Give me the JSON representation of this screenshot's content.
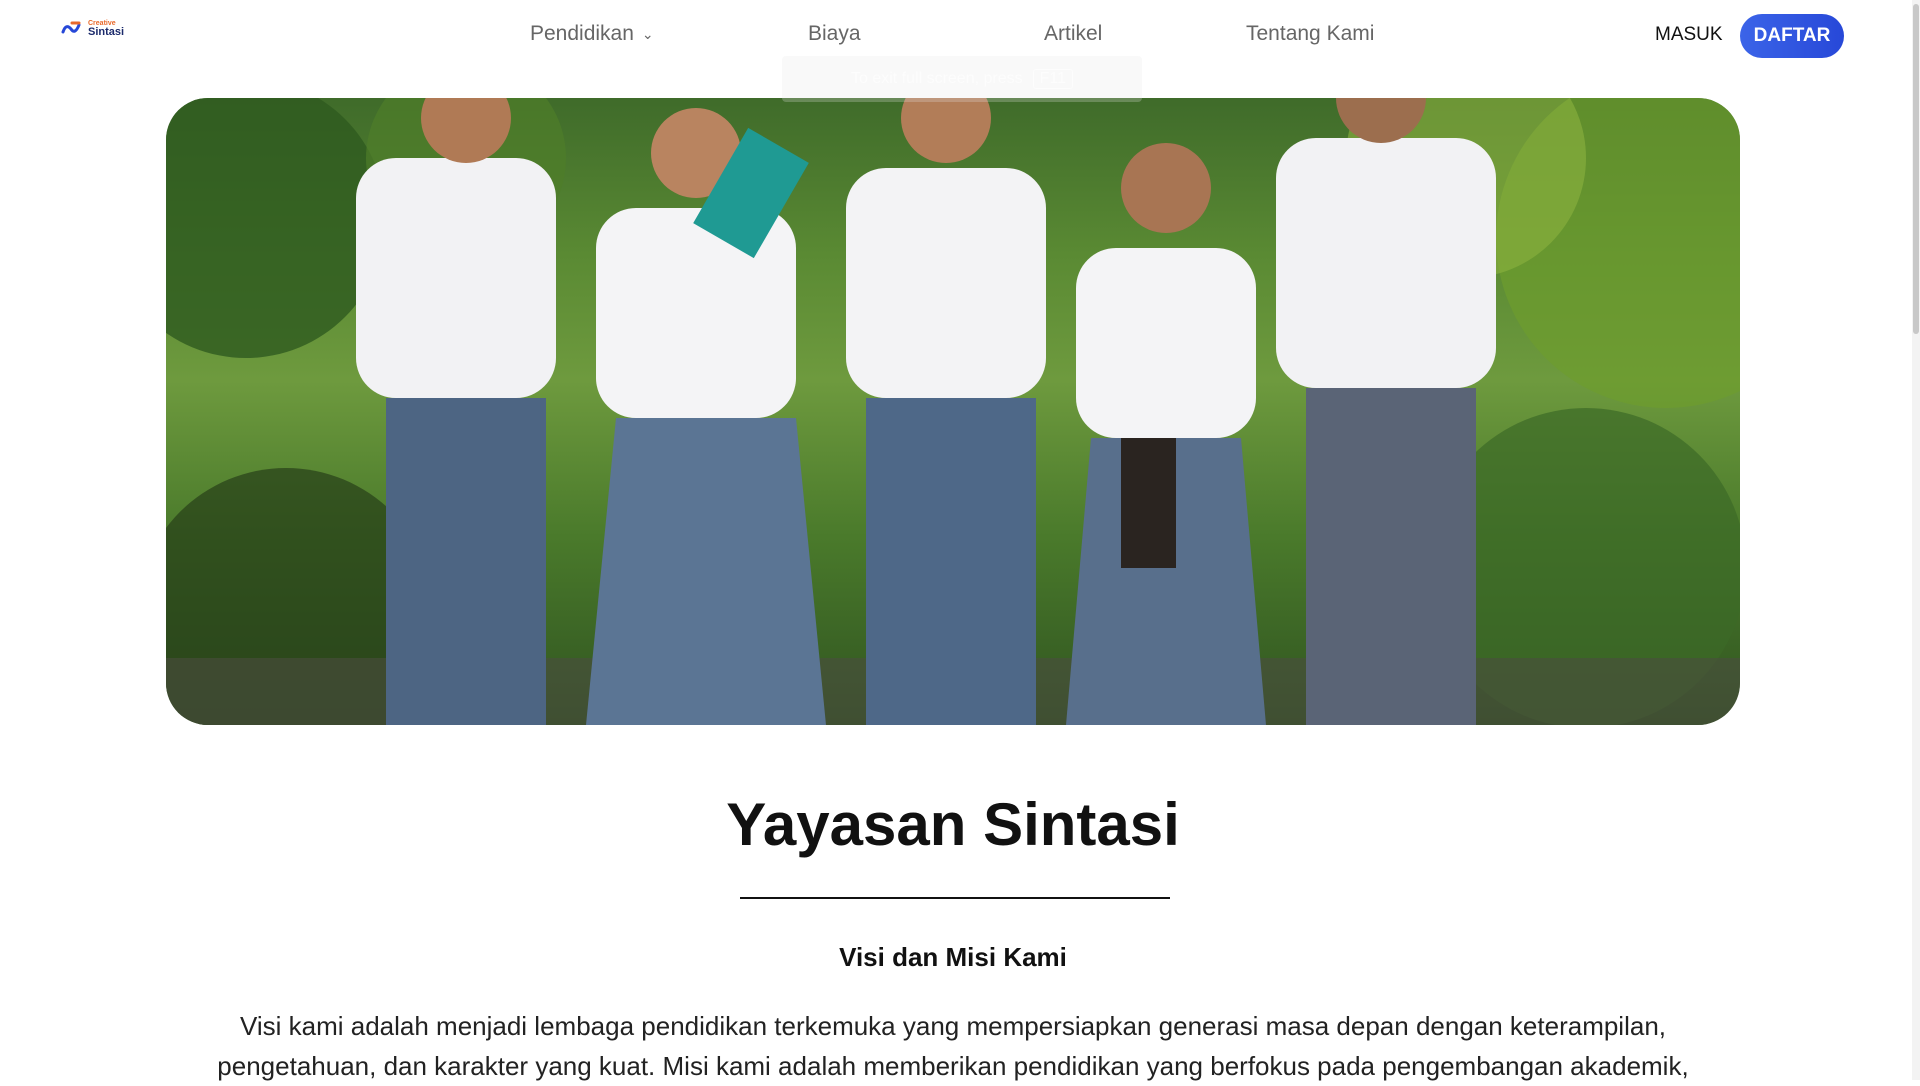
{
  "brand": {
    "small": "Creative",
    "big": "Sintasi"
  },
  "nav": [
    {
      "label": "Pendidikan",
      "has_dropdown": true
    },
    {
      "label": "Biaya"
    },
    {
      "label": "Artikel"
    },
    {
      "label": "Tentang Kami"
    }
  ],
  "auth": {
    "login": "MASUK",
    "register": "DAFTAR"
  },
  "toast": {
    "text": "To exit full screen, press",
    "key": "F11"
  },
  "hero": {
    "image": "students-photo",
    "alt": ""
  },
  "content": {
    "title": "Yayasan Sintasi",
    "subtitle": "Visi dan Misi Kami",
    "paragraph": "Visi kami adalah menjadi lembaga pendidikan terkemuka yang mempersiapkan generasi masa depan dengan keterampilan, pengetahuan, dan karakter yang kuat. Misi kami adalah memberikan pendidikan yang berfokus pada pengembangan akademik,"
  },
  "colors": {
    "accent": "#2f55e0",
    "logo_orange": "#e8692b",
    "logo_navy": "#1b2a6b"
  }
}
